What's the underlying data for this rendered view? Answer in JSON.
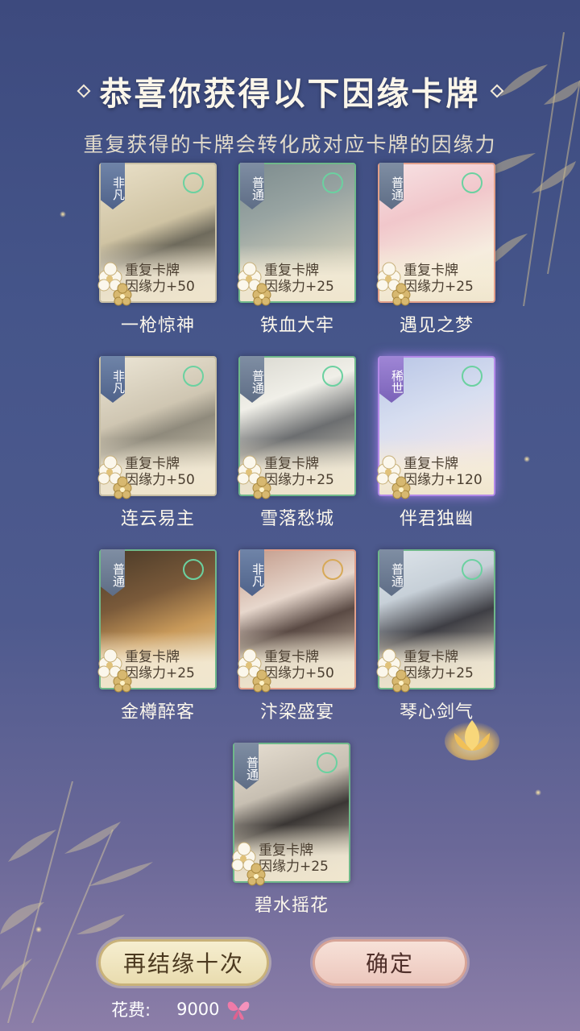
{
  "header": {
    "title": "恭喜你获得以下因缘卡牌",
    "subtitle": "重复获得的卡牌会转化成对应卡牌的因缘力"
  },
  "cards": [
    {
      "rarity": "非凡",
      "status": "重复卡牌",
      "power": "因缘力+50",
      "name": "一枪惊神"
    },
    {
      "rarity": "普通",
      "status": "重复卡牌",
      "power": "因缘力+25",
      "name": "铁血大牢"
    },
    {
      "rarity": "普通",
      "status": "重复卡牌",
      "power": "因缘力+25",
      "name": "遇见之梦"
    },
    {
      "rarity": "非凡",
      "status": "重复卡牌",
      "power": "因缘力+50",
      "name": "连云易主"
    },
    {
      "rarity": "普通",
      "status": "重复卡牌",
      "power": "因缘力+25",
      "name": "雪落愁城"
    },
    {
      "rarity": "稀世",
      "status": "重复卡牌",
      "power": "因缘力+120",
      "name": "伴君独幽"
    },
    {
      "rarity": "普通",
      "status": "重复卡牌",
      "power": "因缘力+25",
      "name": "金樽醉客"
    },
    {
      "rarity": "非凡",
      "status": "重复卡牌",
      "power": "因缘力+50",
      "name": "汴梁盛宴"
    },
    {
      "rarity": "普通",
      "status": "重复卡牌",
      "power": "因缘力+25",
      "name": "琴心剑气"
    },
    {
      "rarity": "普通",
      "status": "重复卡牌",
      "power": "因缘力+25",
      "name": "碧水摇花"
    }
  ],
  "actions": {
    "again_label": "再结缘十次",
    "confirm_label": "确定"
  },
  "cost": {
    "label": "花费:",
    "value": "9000",
    "icon": "butterfly-icon"
  },
  "colors": {
    "accent_gold": "#e9dcaf",
    "accent_pink": "#ecc7bd",
    "rare_purple": "#b48ae8"
  }
}
